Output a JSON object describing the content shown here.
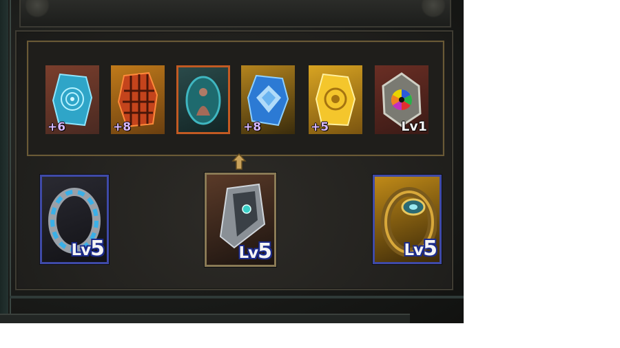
{
  "gems": [
    {
      "id": "cyan-spiral-rune",
      "level": "+6",
      "frame": "#8a4a2a",
      "bg": "#5a3326"
    },
    {
      "id": "orange-lattice-rune",
      "level": "+8",
      "frame": "#a2601c",
      "bg": "#6a3d12"
    },
    {
      "id": "teal-figure-rune",
      "level": "",
      "frame": "#b85a24",
      "bg": "#1f3a3a"
    },
    {
      "id": "blue-crystal-rune",
      "level": "+8",
      "frame": "#a77a1e",
      "bg": "#3a2f10"
    },
    {
      "id": "gold-sun-rune",
      "level": "+5",
      "frame": "#b88a1a",
      "bg": "#6a4c0c"
    },
    {
      "id": "rainbow-eye-rune",
      "level": "Lv1",
      "frame": "#5a2a20",
      "bg": "#4a221c"
    }
  ],
  "equipment": [
    {
      "id": "sapphire-ring",
      "level_prefix": "Lv",
      "level_num": "5"
    },
    {
      "id": "steel-bracer",
      "level_prefix": "Lv",
      "level_num": "5"
    },
    {
      "id": "gold-eye-bracelet",
      "level_prefix": "Lv",
      "level_num": "5"
    }
  ]
}
